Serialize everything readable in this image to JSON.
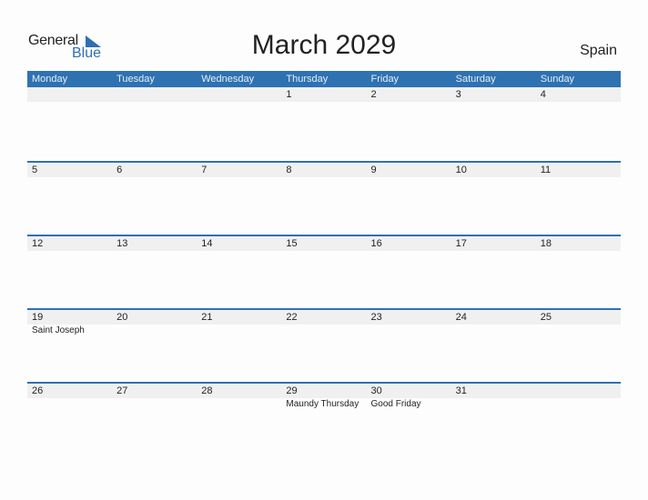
{
  "logo": {
    "line1": "General",
    "line2": "Blue"
  },
  "title": "March 2029",
  "country": "Spain",
  "colors": {
    "accent": "#2e72b2",
    "row_bg": "#f0f0f0"
  },
  "weekdays": [
    "Monday",
    "Tuesday",
    "Wednesday",
    "Thursday",
    "Friday",
    "Saturday",
    "Sunday"
  ],
  "weeks": [
    {
      "dates": [
        "",
        "",
        "",
        "1",
        "2",
        "3",
        "4"
      ],
      "events": [
        "",
        "",
        "",
        "",
        "",
        "",
        ""
      ]
    },
    {
      "dates": [
        "5",
        "6",
        "7",
        "8",
        "9",
        "10",
        "11"
      ],
      "events": [
        "",
        "",
        "",
        "",
        "",
        "",
        ""
      ]
    },
    {
      "dates": [
        "12",
        "13",
        "14",
        "15",
        "16",
        "17",
        "18"
      ],
      "events": [
        "",
        "",
        "",
        "",
        "",
        "",
        ""
      ]
    },
    {
      "dates": [
        "19",
        "20",
        "21",
        "22",
        "23",
        "24",
        "25"
      ],
      "events": [
        "Saint Joseph",
        "",
        "",
        "",
        "",
        "",
        ""
      ]
    },
    {
      "dates": [
        "26",
        "27",
        "28",
        "29",
        "30",
        "31",
        ""
      ],
      "events": [
        "",
        "",
        "",
        "Maundy Thursday",
        "Good Friday",
        "",
        ""
      ]
    }
  ]
}
